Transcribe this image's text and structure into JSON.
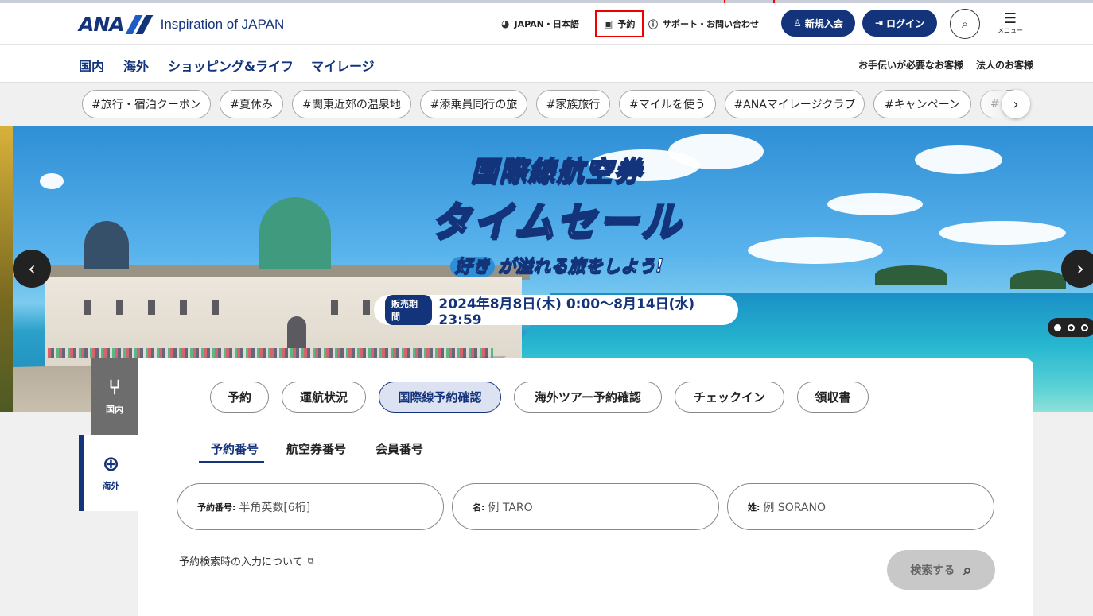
{
  "header": {
    "logo_mark": "ANA",
    "logo_tagline": "Inspiration of JAPAN",
    "language": "JAPAN・日本語",
    "booking": "予約",
    "support": "サポート・お問い合わせ",
    "join": "新規入会",
    "login": "ログイン",
    "menu": "メニュー"
  },
  "nav": {
    "items": [
      "国内",
      "海外",
      "ショッピング&ライフ",
      "マイレージ"
    ],
    "assist": "お手伝いが必要なお客様",
    "corporate": "法人のお客様"
  },
  "tags": [
    "#旅行・宿泊クーポン",
    "#夏休み",
    "#関東近郊の温泉地",
    "#添乗員同行の旅",
    "#家族旅行",
    "#マイルを使う",
    "#ANAマイレージクラブ",
    "#キャンペーン",
    "#"
  ],
  "hero": {
    "line1": "国際線航空券",
    "line2": "タイムセール",
    "line3_badge": "好き",
    "line3": "が溢れる旅をしよう!",
    "period_label": "販売期間",
    "period": "2024年8月8日(木) 0:00〜8月14日(水) 23:59"
  },
  "side": {
    "domestic": "国内",
    "international": "海外"
  },
  "panel": {
    "tabs": [
      "予約",
      "運航状況",
      "国際線予約確認",
      "海外ツアー予約確認",
      "チェックイン",
      "領収書"
    ],
    "subtabs": [
      "予約番号",
      "航空券番号",
      "会員番号"
    ],
    "fields": [
      {
        "label": "予約番号:",
        "placeholder": "半角英数[6桁]"
      },
      {
        "label": "名:",
        "placeholder": "例 TARO"
      },
      {
        "label": "姓:",
        "placeholder": "例 SORANO"
      }
    ],
    "note": "予約検索時の入力について",
    "submit": "検索する"
  },
  "colors": {
    "brand": "#13337a",
    "accent": "#1e5bc6",
    "focus": "#e00000"
  }
}
